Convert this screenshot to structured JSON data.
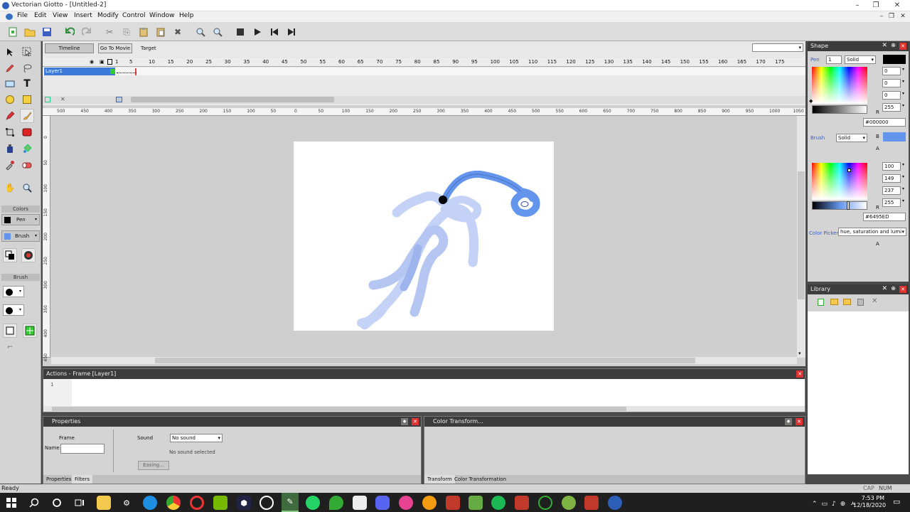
{
  "window": {
    "title": "Vectorian Giotto - [Untitled-2]"
  },
  "menu": [
    "File",
    "Edit",
    "View",
    "Insert",
    "Modify",
    "Control",
    "Window",
    "Help"
  ],
  "timeline": {
    "tab_timeline": "Timeline",
    "tab_go_to_movie": "Go To Movie",
    "target_label": "Target",
    "layer_name": "Layer1",
    "frame_ticks": [
      "1",
      "5",
      "10",
      "15",
      "20",
      "25",
      "30",
      "35",
      "40",
      "45",
      "50",
      "55",
      "60",
      "65",
      "70",
      "75",
      "80",
      "85",
      "90",
      "95",
      "100",
      "105",
      "110",
      "115",
      "120",
      "125",
      "130",
      "135",
      "140",
      "145",
      "150",
      "155",
      "160",
      "165",
      "170",
      "175"
    ]
  },
  "hruler": [
    "500",
    "450",
    "400",
    "350",
    "300",
    "250",
    "200",
    "150",
    "100",
    "50",
    "0",
    "50",
    "100",
    "150",
    "200",
    "250",
    "300",
    "350",
    "400",
    "450",
    "500",
    "550",
    "600",
    "650",
    "700",
    "750",
    "800",
    "850",
    "900",
    "950",
    "1000",
    "1050"
  ],
  "vruler": [
    "0",
    "50",
    "100",
    "150",
    "200",
    "250",
    "300",
    "350",
    "400",
    "450"
  ],
  "tools": {
    "colors_label": "Colors",
    "pen_label": "Pen",
    "brush_label": "Brush",
    "brush_section": "Brush"
  },
  "shape_panel": {
    "title": "Shape",
    "pen_label": "Pen",
    "pen_width": "1",
    "pen_style": "Solid",
    "pen_rgba": {
      "r": "0",
      "g": "0",
      "b": "0",
      "a": "255"
    },
    "pen_hex": "#000000",
    "pen_color": "#000000",
    "brush_label": "Brush",
    "brush_style": "Solid",
    "brush_rgba": {
      "r": "100",
      "g": "149",
      "b": "237",
      "a": "255"
    },
    "brush_hex": "#6495ED",
    "brush_color": "#6495ED",
    "color_picker_label": "Color Picker",
    "color_picker_value": "hue, saturation and lumir",
    "letters": {
      "r": "R",
      "g": "G",
      "b": "B",
      "a": "A"
    }
  },
  "library_panel": {
    "title": "Library"
  },
  "actions_panel": {
    "title": "Actions - Frame [Layer1]",
    "line": "1"
  },
  "properties_panel": {
    "title": "Properties",
    "frame_label": "Frame",
    "name_label": "Name",
    "sound_label": "Sound",
    "sound_value": "No sound",
    "no_sound": "No sound selected",
    "easing": "Easing...",
    "tab_properties": "Properties",
    "tab_filters": "Filters"
  },
  "color_transform_panel": {
    "title": "Color Transform...",
    "tab_transform": "Transform",
    "tab_color_transformation": "Color Transformation"
  },
  "status": {
    "left": "Ready",
    "caps": "CAP",
    "num": "NUM"
  },
  "taskbar": {
    "time": "7:53 PM",
    "date": "12/18/2020"
  }
}
